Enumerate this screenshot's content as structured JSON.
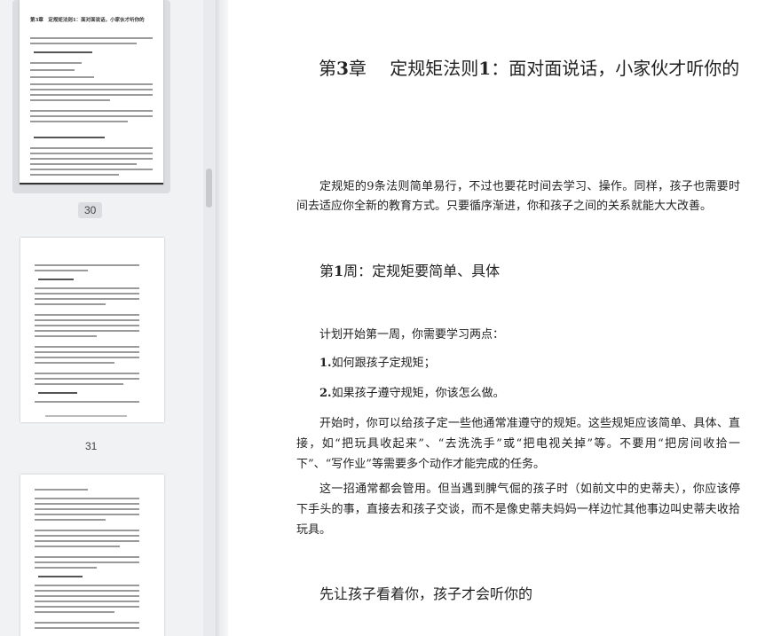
{
  "sidebar": {
    "thumbnails": [
      {
        "page_label": "30",
        "active": true,
        "lines": [
          "第3章　定规矩法则1：面对面说话，小家伙才听你的",
          "定规矩第一周：简单、具体",
          "先让孩子看着你，孩子才会听你的"
        ]
      },
      {
        "page_label": "31",
        "active": false,
        "lines": [
          "第1周：定规矩要简单、具体"
        ]
      },
      {
        "page_label": "",
        "active": false,
        "lines": []
      }
    ]
  },
  "document": {
    "chapter_prefix": "第",
    "chapter_num": "3",
    "chapter_rest": "章　 定规矩法则",
    "chapter_rule_num": "1",
    "chapter_title_rest": "：面对面说话，小家伙才听你的",
    "intro_paragraph": "定规矩的9条法则简单易行，不过也要花时间去学习、操作。同样，孩子也需要时间去适应你全新的教育方式。只要循序渐进，你和孩子之间的关系就能大大改善。",
    "week_heading_prefix": "第",
    "week_heading_num": "1",
    "week_heading_rest": "周：定规矩要简单、具体",
    "plan_intro": "计划开始第一周，你需要学习两点：",
    "point1_num": "1.",
    "point1_text": "如何跟孩子定规矩；",
    "point2_num": "2.",
    "point2_text": "如果孩子遵守规矩，你该怎么做。",
    "paragraph_start": "开始时，你可以给孩子定一些他通常准遵守的规矩。这些规矩应该简单、具体、直接，如“把玩具收起来”、“去洗洗手”或“把电视关掉”等。不要用“把房间收拾一下”、“写作业”等需要多个动作才能完成的任务。",
    "paragraph_trick": "这一招通常都会管用。但当遇到脾气倔的孩子时（如前文中的史蒂夫），你应该停下手头的事，直接去和孩子交谈，而不是像史蒂夫妈妈一样边忙其他事边叫史蒂夫收拾玩具。",
    "section_heading": "先让孩子看着你，孩子才会听你的"
  }
}
